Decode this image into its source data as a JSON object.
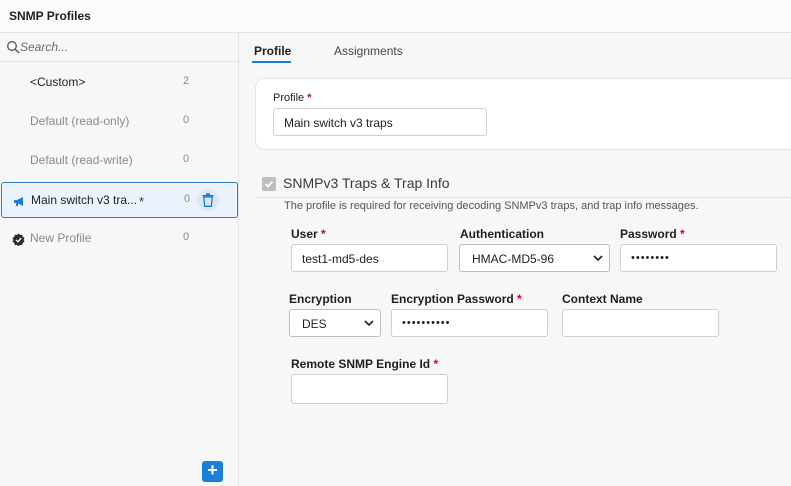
{
  "window": {
    "title": "SNMP Profiles"
  },
  "search": {
    "placeholder": "Search..."
  },
  "sidebar": {
    "items": [
      {
        "label": "<Custom>",
        "count": "2"
      },
      {
        "label": "Default (read-only)",
        "count": "0"
      },
      {
        "label": "Default (read-write)",
        "count": "0"
      },
      {
        "label": "Main switch v3 tra...",
        "count": "0",
        "modified_marker": "*"
      },
      {
        "label": "New Profile",
        "count": "0"
      }
    ],
    "add_label": "+"
  },
  "tabs": [
    {
      "label": "Profile"
    },
    {
      "label": "Assignments"
    }
  ],
  "profile": {
    "label": "Profile",
    "required": "*",
    "value": "Main switch v3 traps"
  },
  "section": {
    "title": "SNMPv3 Traps & Trap Info",
    "description": "The profile is required for receiving decoding SNMPv3 traps, and trap info messages."
  },
  "fields": {
    "user": {
      "label": "User",
      "required": "*",
      "value": "test1-md5-des"
    },
    "authentication": {
      "label": "Authentication",
      "value": "HMAC-MD5-96"
    },
    "password": {
      "label": "Password",
      "required": "*",
      "value": "••••••••"
    },
    "encryption": {
      "label": "Encryption",
      "value": "DES"
    },
    "encryption_password": {
      "label": "Encryption Password",
      "required": "*",
      "value": "••••••••••"
    },
    "context_name": {
      "label": "Context Name",
      "value": ""
    },
    "remote_engine_id": {
      "label": "Remote SNMP Engine Id",
      "required": "*",
      "value": ""
    }
  },
  "colors": {
    "accent": "#1a7fd9",
    "required": "#d0021b",
    "selected_bg": "#eaf3fb"
  }
}
